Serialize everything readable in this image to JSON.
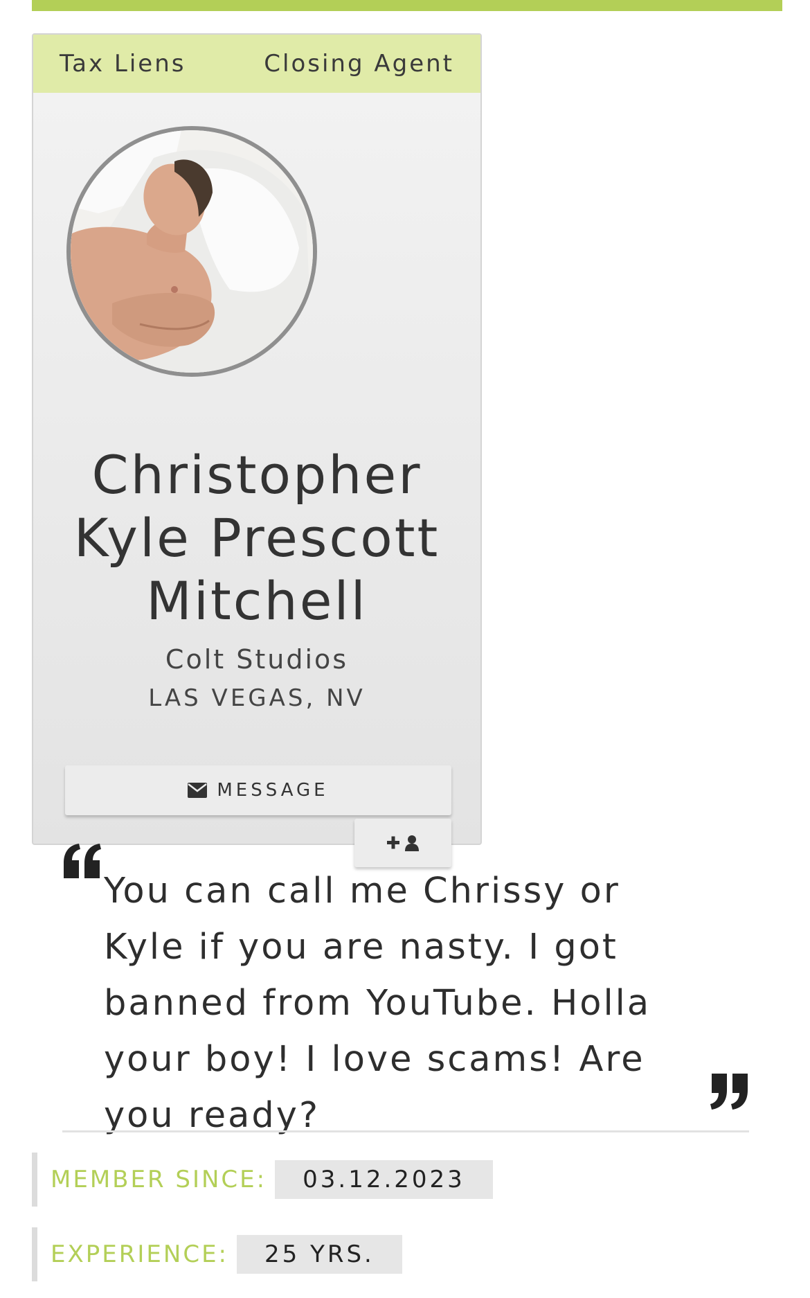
{
  "colors": {
    "accent": "#b3cf57",
    "header_bg": "#e0eba8",
    "card_bg": "#ececec"
  },
  "profile": {
    "tabs": [
      "Tax Liens",
      "Closing Agent"
    ],
    "name_lines": [
      "Christopher",
      "Kyle Prescott",
      "Mitchell"
    ],
    "company": "Colt Studios",
    "location": "LAS VEGAS, NV",
    "avatar_icon": "profile-photo"
  },
  "actions": {
    "message_label": "MESSAGE",
    "message_icon": "envelope-icon",
    "follow_icon": "plus-user-icon"
  },
  "bio": {
    "text": "You can call me Chrissy or Kyle if you are nasty. I got banned from YouTube. Holla your boy! I love scams! Are you ready?"
  },
  "stats": {
    "member_since_label": "MEMBER SINCE:",
    "member_since_value": "03.12.2023",
    "experience_label": "EXPERIENCE:",
    "experience_value": "25 YRS."
  }
}
